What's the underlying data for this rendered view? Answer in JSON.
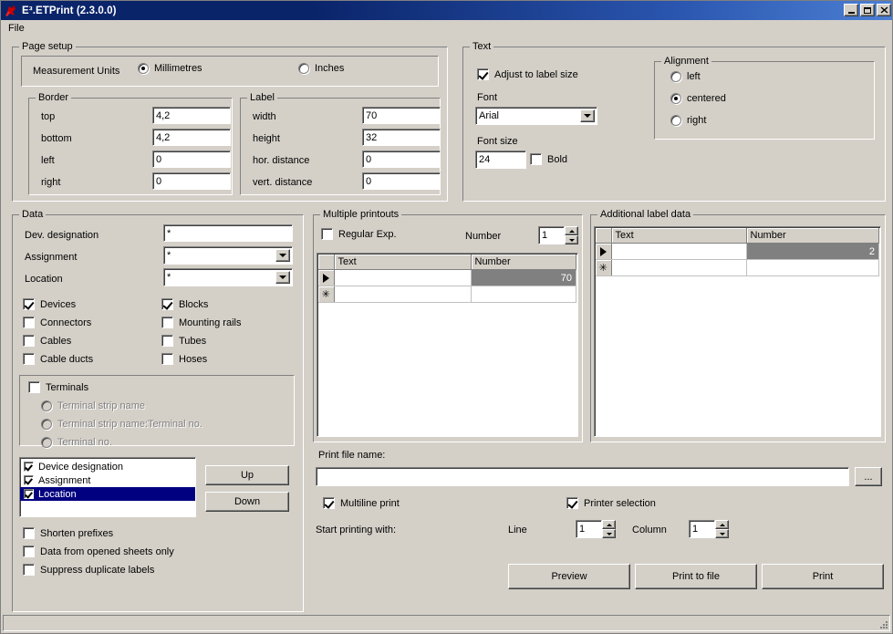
{
  "window": {
    "title": "E³.ETPrint (2.3.0.0)",
    "icon": "app-icon",
    "minimize_label": "_",
    "maximize_label": "□",
    "close_label": "✕"
  },
  "menu": {
    "items": [
      {
        "label": "File"
      }
    ]
  },
  "page_setup": {
    "title": "Page setup",
    "measurement_units_label": "Measurement Units",
    "units": [
      {
        "label": "Millimetres",
        "selected": true
      },
      {
        "label": "Inches",
        "selected": false
      }
    ],
    "border": {
      "title": "Border",
      "fields": [
        {
          "label": "top",
          "value": "4,2"
        },
        {
          "label": "bottom",
          "value": "4,2"
        },
        {
          "label": "left",
          "value": "0"
        },
        {
          "label": "right",
          "value": "0"
        }
      ]
    },
    "label": {
      "title": "Label",
      "fields": [
        {
          "label": "width",
          "value": "70"
        },
        {
          "label": "height",
          "value": "32"
        },
        {
          "label": "hor. distance",
          "value": "0"
        },
        {
          "label": "vert. distance",
          "value": "0"
        }
      ]
    }
  },
  "text_section": {
    "title": "Text",
    "adjust_to_label_size": {
      "label": "Adjust to label size",
      "checked": true
    },
    "font_label": "Font",
    "font_value": "Arial",
    "font_size_label": "Font size",
    "font_size_value": "24",
    "bold": {
      "label": "Bold",
      "checked": false
    },
    "alignment": {
      "title": "Alignment",
      "options": [
        {
          "label": "left",
          "selected": false
        },
        {
          "label": "centered",
          "selected": true
        },
        {
          "label": "right",
          "selected": false
        }
      ]
    }
  },
  "data_section": {
    "title": "Data",
    "fields": [
      {
        "label": "Dev. designation",
        "value": "*",
        "type": "text"
      },
      {
        "label": "Assignment",
        "value": "*",
        "type": "combo"
      },
      {
        "label": "Location",
        "value": "*",
        "type": "combo"
      }
    ],
    "checkboxes_left": [
      {
        "label": "Devices",
        "checked": true
      },
      {
        "label": "Connectors",
        "checked": false
      },
      {
        "label": "Cables",
        "checked": false
      },
      {
        "label": "Cable ducts",
        "checked": false
      }
    ],
    "checkboxes_right": [
      {
        "label": "Blocks",
        "checked": true
      },
      {
        "label": "Mounting rails",
        "checked": false
      },
      {
        "label": "Tubes",
        "checked": false
      },
      {
        "label": "Hoses",
        "checked": false
      }
    ],
    "terminals": {
      "label": "Terminals",
      "checked": false,
      "options": [
        {
          "label": "Terminal strip name",
          "selected": false,
          "disabled": true
        },
        {
          "label": "Terminal strip name:Terminal no.",
          "selected": false,
          "disabled": true
        },
        {
          "label": "Terminal no.",
          "selected": false,
          "disabled": true
        }
      ]
    },
    "order_list": [
      {
        "label": "Device designation",
        "checked": true,
        "selected": false
      },
      {
        "label": "Assignment",
        "checked": true,
        "selected": false
      },
      {
        "label": "Location",
        "checked": true,
        "selected": true
      }
    ],
    "up_button": "Up",
    "down_button": "Down",
    "options": [
      {
        "label": "Shorten prefixes",
        "checked": false
      },
      {
        "label": "Data from opened sheets only",
        "checked": false
      },
      {
        "label": "Suppress duplicate labels",
        "checked": false
      }
    ]
  },
  "multiple_printouts": {
    "title": "Multiple printouts",
    "regular_exp": {
      "label": "Regular Exp.",
      "checked": false
    },
    "number_label": "Number",
    "number_value": "1",
    "grid": {
      "columns": [
        "Text",
        "Number"
      ],
      "rows": [
        {
          "marker": "arrow",
          "text": "",
          "number": "70",
          "selected_cell": "number"
        },
        {
          "marker": "star",
          "text": "",
          "number": "",
          "selected_cell": ""
        }
      ]
    }
  },
  "additional_label_data": {
    "title": "Additional label data",
    "grid": {
      "columns": [
        "Text",
        "Number"
      ],
      "rows": [
        {
          "marker": "arrow",
          "text": "",
          "number": "2",
          "selected_cell": "number"
        },
        {
          "marker": "star",
          "text": "",
          "number": "",
          "selected_cell": ""
        }
      ]
    }
  },
  "print_section": {
    "file_name_label": "Print file name:",
    "file_name_value": "",
    "browse_button": "...",
    "multiline_print": {
      "label": "Multiline print",
      "checked": true
    },
    "printer_selection": {
      "label": "Printer selection",
      "checked": true
    },
    "start_printing_label": "Start printing with:",
    "line_label": "Line",
    "line_value": "1",
    "column_label": "Column",
    "column_value": "1",
    "buttons": [
      {
        "label": "Preview"
      },
      {
        "label": "Print to file"
      },
      {
        "label": "Print"
      }
    ]
  },
  "colors": {
    "window_face": "#d4d0c8",
    "title_bar_start": "#0a246a",
    "title_bar_end": "#4b7fd4",
    "selection": "#000080",
    "grid_selection": "#808080",
    "field_bg": "#ffffff"
  }
}
